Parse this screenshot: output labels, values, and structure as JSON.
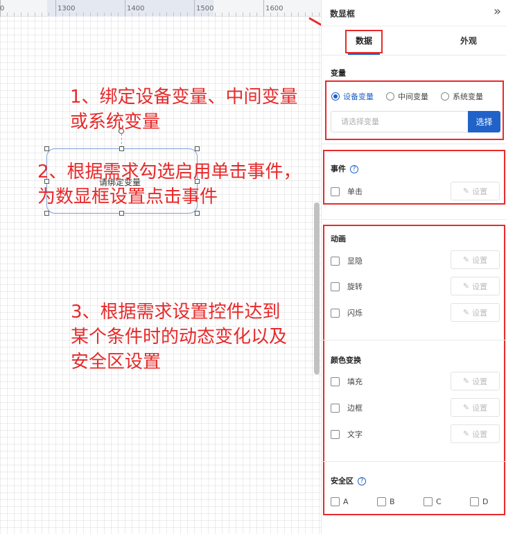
{
  "ruler": {
    "labels": [
      "0",
      "1300",
      "1400",
      "1500",
      "1600"
    ]
  },
  "canvas": {
    "widget_text": "请绑定变量"
  },
  "annotations": {
    "a1": [
      "1、绑定设备变量、中间变量",
      "或系统变量"
    ],
    "a2": [
      "2、根据需求勾选启用单击事件，",
      "为数显框设置点击事件"
    ],
    "a3": [
      "3、根据需求设置控件达到",
      "某个条件时的动态变化以及",
      "安全区设置"
    ]
  },
  "panel": {
    "title": "数显框",
    "collapse_icon": "double-chevron-right-icon",
    "tabs": [
      {
        "label": "数据",
        "active": true
      },
      {
        "label": "外观",
        "active": false
      }
    ],
    "variable": {
      "title": "变量",
      "options": [
        "设备变量",
        "中间变量",
        "系统变量"
      ],
      "selected": "设备变量",
      "placeholder": "请选择变量",
      "select_label": "选择"
    },
    "event": {
      "title": "事件",
      "help": "?",
      "items": [
        {
          "label": "单击",
          "button": "设置"
        }
      ]
    },
    "animation": {
      "title": "动画",
      "items": [
        {
          "label": "显隐",
          "button": "设置"
        },
        {
          "label": "旋转",
          "button": "设置"
        },
        {
          "label": "闪烁",
          "button": "设置"
        }
      ]
    },
    "color_change": {
      "title": "颜色变换",
      "items": [
        {
          "label": "填充",
          "button": "设置"
        },
        {
          "label": "边框",
          "button": "设置"
        },
        {
          "label": "文字",
          "button": "设置"
        }
      ]
    },
    "safe_zone": {
      "title": "安全区",
      "help": "?",
      "items": [
        "A",
        "B",
        "C",
        "D"
      ]
    }
  },
  "colors": {
    "accent": "#2162c9",
    "annotation_red": "#e8292a"
  }
}
